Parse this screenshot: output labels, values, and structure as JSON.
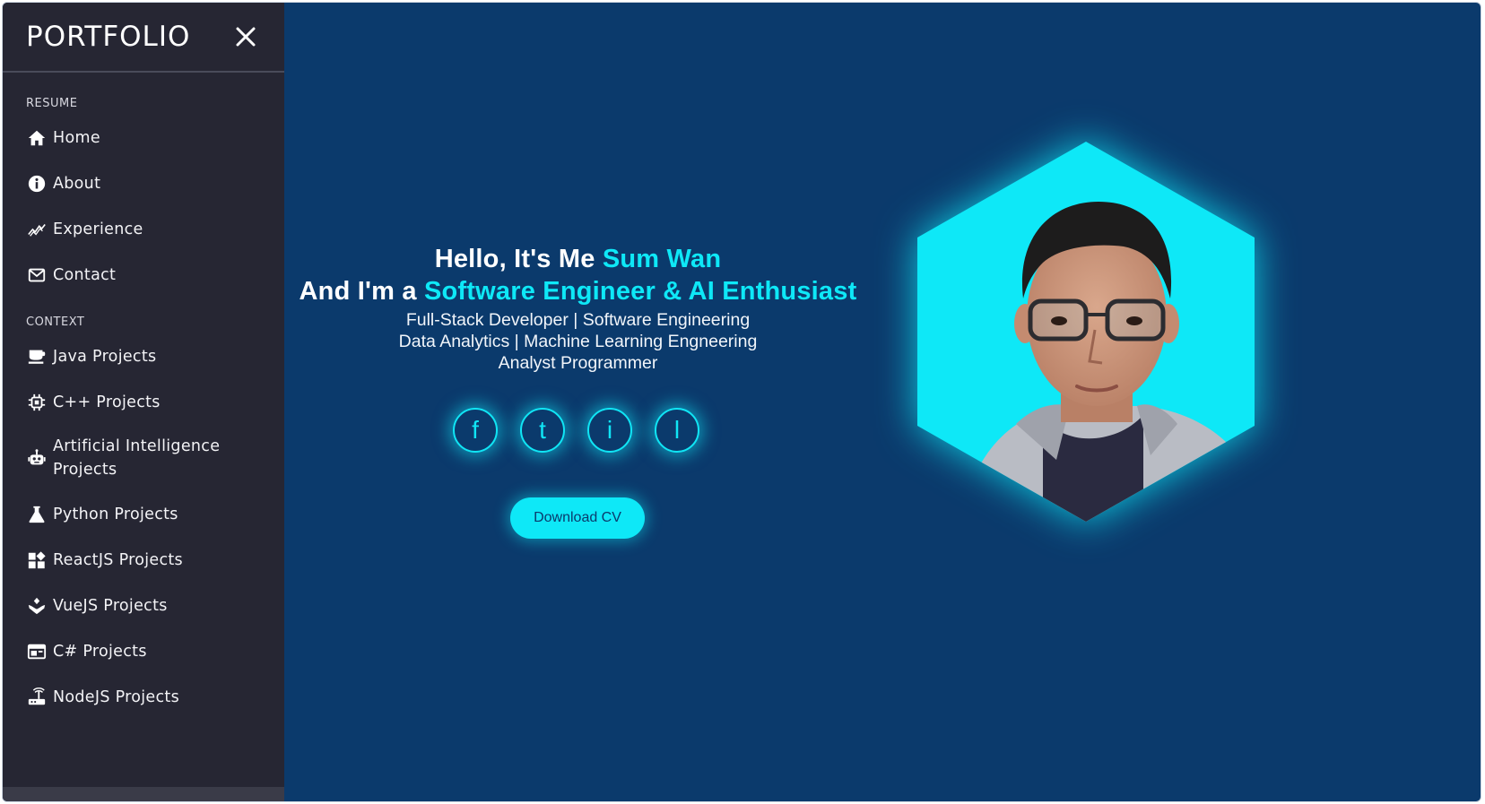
{
  "sidebar": {
    "brand": "PORTFOLIO",
    "sections": [
      {
        "label": "RESUME"
      },
      {
        "label": "CONTEXT"
      }
    ],
    "items": [
      {
        "label": "Home",
        "icon": "home-icon"
      },
      {
        "label": "About",
        "icon": "info-icon"
      },
      {
        "label": "Experience",
        "icon": "trend-icon"
      },
      {
        "label": "Contact",
        "icon": "mail-icon"
      },
      {
        "label": "Java Projects",
        "icon": "cup-icon"
      },
      {
        "label": "C++ Projects",
        "icon": "chip-icon"
      },
      {
        "label": "Artificial Intelligence Projects",
        "icon": "robot-icon"
      },
      {
        "label": "Python Projects",
        "icon": "flask-icon"
      },
      {
        "label": "ReactJS Projects",
        "icon": "widgets-icon"
      },
      {
        "label": "VueJS Projects",
        "icon": "hands-icon"
      },
      {
        "label": "C# Projects",
        "icon": "window-icon"
      },
      {
        "label": "NodeJS Projects",
        "icon": "router-icon"
      }
    ]
  },
  "hero": {
    "greeting_prefix": "Hello, It's Me ",
    "name": "Sum Wan",
    "role_prefix": "And I'm a ",
    "role": "Software Engineer & AI Enthusiast",
    "subtitles": [
      "Full-Stack Developer | Software Engineering",
      "Data Analytics | Machine Learning Engneering",
      "Analyst Programmer"
    ],
    "socials": [
      "f",
      "t",
      "i",
      "l"
    ],
    "cv_label": "Download CV"
  },
  "colors": {
    "background": "#0b3a6c",
    "sidebar": "#262633",
    "accent": "#0ee8f7"
  }
}
